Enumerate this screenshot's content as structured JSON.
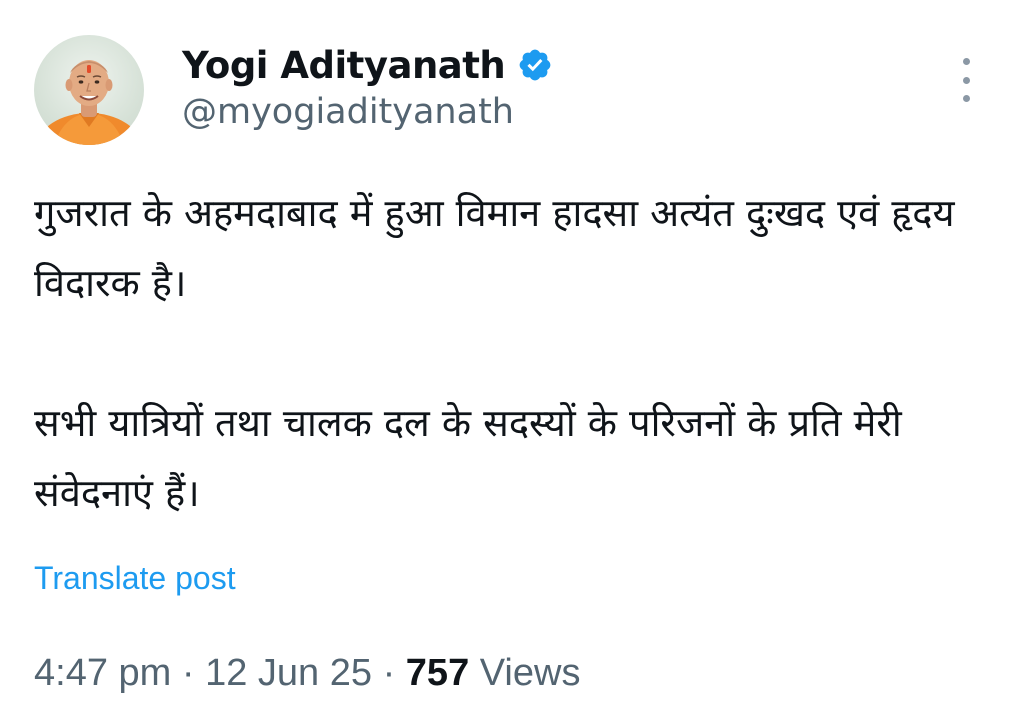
{
  "author": {
    "display_name": "Yogi Adityanath",
    "handle": "@myogiadityanath",
    "verified": true,
    "avatar_icon": "profile-photo"
  },
  "post": {
    "paragraphs": [
      "गुजरात के अहमदाबाद में हुआ विमान हादसा अत्यंत दुःखद एवं हृदय विदारक है।",
      "सभी यात्रियों तथा चालक दल के सदस्यों के परिजनों के प्रति मेरी संवेदनाएं हैं।"
    ],
    "translate_label": "Translate post"
  },
  "meta": {
    "time": "4:47 pm",
    "separator": "·",
    "date": "12 Jun 25",
    "views_count": "757",
    "views_label": "Views"
  },
  "menu": {
    "more_icon": "more-vertical-icon"
  },
  "colors": {
    "accent": "#1d9bf0",
    "text_primary": "#0f1419",
    "text_secondary": "#536471"
  }
}
